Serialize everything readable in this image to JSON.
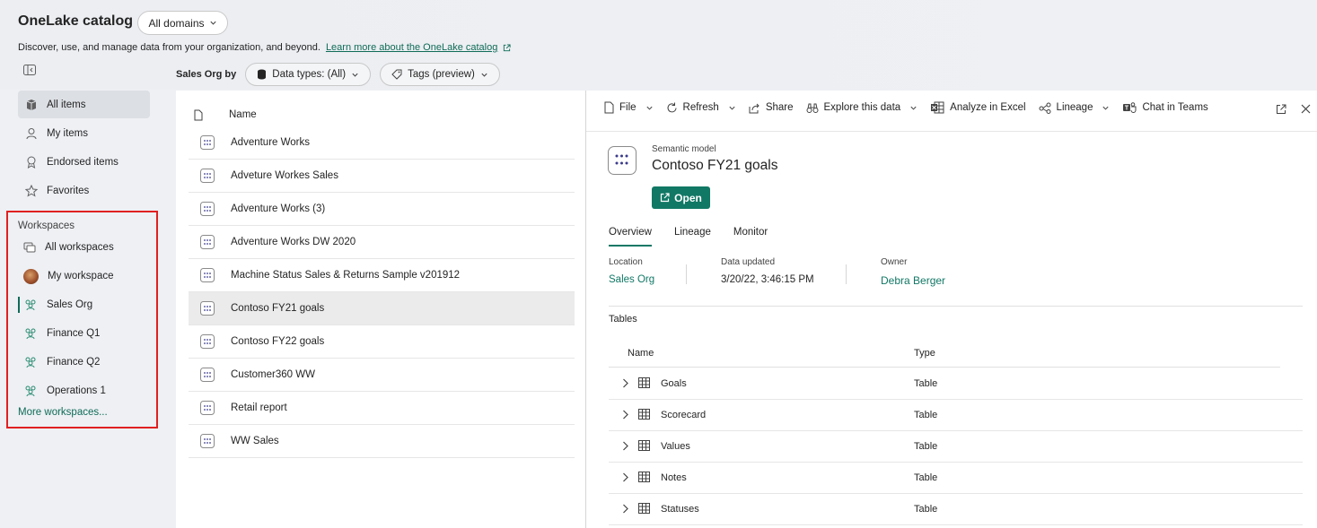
{
  "header": {
    "title": "OneLake catalog",
    "domain_filter": "All domains",
    "subtitle": "Discover, use, and manage data from your organization, and beyond.",
    "learn_more": "Learn more about the OneLake catalog"
  },
  "filters": {
    "label": "Sales Org by",
    "data_types": "Data types: (All)",
    "tags": "Tags (preview)"
  },
  "sidebar": {
    "items": [
      {
        "label": "All items",
        "icon": "cube-icon"
      },
      {
        "label": "My items",
        "icon": "person-icon"
      },
      {
        "label": "Endorsed items",
        "icon": "ribbon-icon"
      },
      {
        "label": "Favorites",
        "icon": "star-icon"
      }
    ],
    "workspaces_header": "Workspaces",
    "workspaces": [
      {
        "label": "All workspaces",
        "icon": "workspaces-icon"
      },
      {
        "label": "My workspace",
        "icon": "avatar"
      },
      {
        "label": "Sales Org",
        "icon": "people-icon"
      },
      {
        "label": "Finance Q1",
        "icon": "people-icon"
      },
      {
        "label": "Finance Q2",
        "icon": "people-icon"
      },
      {
        "label": "Operations 1",
        "icon": "people-icon"
      }
    ],
    "more_workspaces": "More workspaces..."
  },
  "list": {
    "column_name": "Name",
    "items": [
      "Adventure Works",
      "Adveture Workes Sales",
      "Adventure Works (3)",
      "Adventure Works DW 2020",
      "Machine Status Sales & Returns Sample v201912",
      "Contoso FY21 goals",
      "Contoso FY22 goals",
      "Customer360 WW",
      "Retail report",
      "WW Sales"
    ],
    "selected": "Contoso FY21 goals"
  },
  "toolbar": {
    "file": "File",
    "refresh": "Refresh",
    "share": "Share",
    "explore": "Explore this data",
    "analyze": "Analyze in Excel",
    "lineage": "Lineage",
    "chat": "Chat in Teams"
  },
  "detail": {
    "type": "Semantic model",
    "name": "Contoso FY21 goals",
    "open": "Open",
    "tabs": [
      "Overview",
      "Lineage",
      "Monitor"
    ],
    "location_label": "Location",
    "location_value": "Sales Org",
    "updated_label": "Data updated",
    "updated_value": "3/20/22, 3:46:15 PM",
    "owner_label": "Owner",
    "owner_value": "Debra Berger",
    "tables_label": "Tables",
    "col_name": "Name",
    "col_type": "Type",
    "tables": [
      {
        "name": "Goals",
        "type": "Table"
      },
      {
        "name": "Scorecard",
        "type": "Table"
      },
      {
        "name": "Values",
        "type": "Table"
      },
      {
        "name": "Notes",
        "type": "Table"
      },
      {
        "name": "Statuses",
        "type": "Table"
      }
    ]
  },
  "colors": {
    "accent": "#117865",
    "highlight_box": "#e02020"
  }
}
